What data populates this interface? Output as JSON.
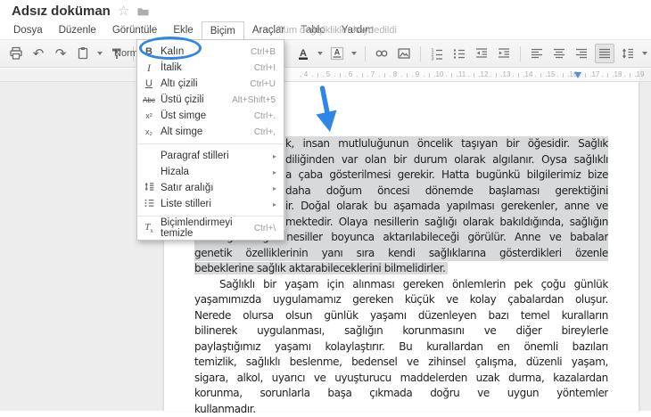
{
  "header": {
    "doc_title": "Adsız doküman",
    "star_icon": "☆",
    "menu_items": [
      {
        "label": "Dosya"
      },
      {
        "label": "Düzenle"
      },
      {
        "label": "Görüntüle"
      },
      {
        "label": "Ekle"
      },
      {
        "label": "Biçim",
        "active": true
      },
      {
        "label": "Araçlar"
      },
      {
        "label": "Tablo"
      },
      {
        "label": "Yardım"
      }
    ],
    "save_status": "Tüm değişiklikler kaydedildi"
  },
  "toolbar": {
    "left_icons": [
      "print-icon",
      "undo-icon",
      "redo-icon",
      "paste-icon",
      "dropdown-caret-icon",
      "paint-format-icon",
      "separator"
    ],
    "style_selector": "Normal m...",
    "right_icons": [
      "text-color-icon",
      "dropdown-caret-icon",
      "highlight-color-icon",
      "dropdown-caret-icon",
      "separator",
      "insert-link-icon",
      "insert-image-icon",
      "separator",
      "numbered-list-icon",
      "bulleted-list-icon",
      "decrease-indent-icon",
      "increase-indent-icon",
      "separator",
      "align-left-icon",
      "align-center-icon",
      "align-right-icon",
      "justify-icon",
      "line-spacing-icon",
      "dropdown-caret-icon"
    ],
    "active_icon": "justify-icon"
  },
  "ruler": {
    "numbers": [
      4,
      5,
      6,
      7,
      8,
      9,
      10,
      11,
      12,
      13,
      14,
      15,
      16,
      17,
      18,
      19
    ],
    "indent_marker_cm": 16.2
  },
  "format_menu": {
    "items": [
      {
        "icon": "bold-icon",
        "label": "Kalın",
        "shortcut": "Ctrl+B",
        "circled": true
      },
      {
        "icon": "italic-icon",
        "label": "İtalik",
        "shortcut": "Ctrl+I"
      },
      {
        "icon": "underline-icon",
        "label": "Altı çizili",
        "shortcut": "Ctrl+U"
      },
      {
        "icon": "strikethrough-icon",
        "label": "Üstü çizili",
        "shortcut": "Alt+Shift+5"
      },
      {
        "icon": "superscript-icon",
        "label": "Üst simge",
        "shortcut": "Ctrl+."
      },
      {
        "icon": "subscript-icon",
        "label": "Alt simge",
        "shortcut": "Ctrl+,"
      },
      {
        "separator": true
      },
      {
        "label": "Paragraf stilleri",
        "submenu": true
      },
      {
        "label": "Hizala",
        "submenu": true
      },
      {
        "icon": "line-spacing-icon",
        "label": "Satır aralığı",
        "submenu": true
      },
      {
        "icon": "list-styles-icon",
        "label": "Liste stilleri",
        "submenu": true
      },
      {
        "separator": true
      },
      {
        "icon": "clear-formatting-icon",
        "label": "Biçimlendirmeyi temizle",
        "shortcut": "Ctrl+\\"
      }
    ]
  },
  "annotations": {
    "accent_color": "#2e86e8",
    "ellipse_target": "Kalın",
    "arrow_target": "selected-text"
  },
  "document": {
    "selection_color": "#d7d9da",
    "lines": [
      {
        "t": "k, insan mutluluğunun öncelik taşıyan bir öğesidir. Sağlık",
        "sel": true,
        "covered": true
      },
      {
        "t": "diliğinden var olan bir durum olarak algılanır. Oysa sağlıklı",
        "sel": true,
        "covered": true
      },
      {
        "t": "a çaba gösterilmesi gerekir. Hatta bugünkü bilgilerimiz bize",
        "sel": true,
        "covered": true
      },
      {
        "t": "daha doğum öncesi dönemde başlaması gerektiğini",
        "sel": true,
        "covered": true
      },
      {
        "t": "ir. Doğal olarak bu aşamada yapılması gerekenler, anne ve",
        "sel": true,
        "covered": true
      },
      {
        "t": "mektedir. Olaya nesillerin sağlığı olarak bakıldığında, sağlığın",
        "sel": true,
        "covered": true
      },
      {
        "t": "ve sağlıksızlığın nesiller boyunca aktarılabileceği görülür. Anne ve babalar",
        "sel": true
      },
      {
        "t": "genetik özelliklerinin yanı sıra kendi sağlıklarına gösterdikleri özenle",
        "sel": true
      },
      {
        "t": "bebeklerine sağlık aktarabileceklerini bilmelidirler.",
        "sel": true,
        "last": true
      },
      {
        "t": "Sağlıklı bir yaşam için alınması gereken önlemlerin pek çoğu günlük",
        "indent": true
      },
      {
        "t": "yaşamımızda uygulamamız gereken küçük ve kolay çabalardan oluşur."
      },
      {
        "t": "Nerede olursa olsun günlük yaşamı düzenleyen bazı temel kuralların"
      },
      {
        "t": "bilinerek uygulanması, sağlığın korunmasını ve diğer bireylerle"
      },
      {
        "t": "paylaştığımız yaşamı kolaylaştırır. Bu kurallardan en önemli bazıları"
      },
      {
        "t": "temizlik, sağlıklı beslenme, bedensel ve zihinsel çalışma, düzenli yaşam,"
      },
      {
        "t": "sigara, alkol, uyarıcı ve uyuşturucu maddelerden uzak durma, kazalardan"
      },
      {
        "t": "korunma, sorunlarla başa çıkmada doğru ve uygun yöntemler"
      },
      {
        "t": "kullanmadır.",
        "last": true
      }
    ]
  }
}
